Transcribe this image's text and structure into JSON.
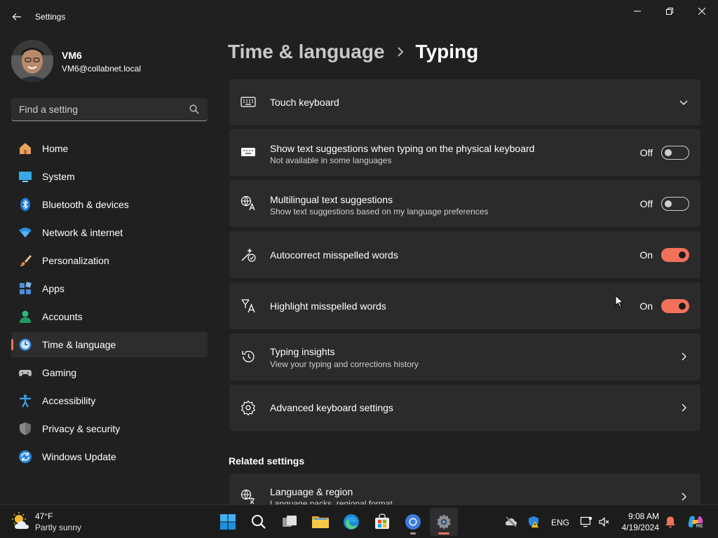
{
  "window": {
    "title": "Settings",
    "back_icon": "back-arrow-icon",
    "minimize_icon": "minimize-icon",
    "restore_icon": "restore-icon",
    "close_icon": "close-icon"
  },
  "profile": {
    "name": "VM6",
    "email": "VM6@collabnet.local"
  },
  "search": {
    "placeholder": "Find a setting",
    "value": ""
  },
  "sidebar": {
    "items": [
      {
        "label": "Home",
        "icon": "home-icon",
        "selected": false
      },
      {
        "label": "System",
        "icon": "system-icon",
        "selected": false
      },
      {
        "label": "Bluetooth & devices",
        "icon": "bluetooth-icon",
        "selected": false
      },
      {
        "label": "Network & internet",
        "icon": "wifi-icon",
        "selected": false
      },
      {
        "label": "Personalization",
        "icon": "brush-icon",
        "selected": false
      },
      {
        "label": "Apps",
        "icon": "apps-icon",
        "selected": false
      },
      {
        "label": "Accounts",
        "icon": "accounts-icon",
        "selected": false
      },
      {
        "label": "Time & language",
        "icon": "time-language-icon",
        "selected": true
      },
      {
        "label": "Gaming",
        "icon": "gaming-icon",
        "selected": false
      },
      {
        "label": "Accessibility",
        "icon": "accessibility-icon",
        "selected": false
      },
      {
        "label": "Privacy & security",
        "icon": "shield-icon",
        "selected": false
      },
      {
        "label": "Windows Update",
        "icon": "windows-update-icon",
        "selected": false
      }
    ]
  },
  "breadcrumb": {
    "parent": "Time & language",
    "current": "Typing"
  },
  "settings": [
    {
      "title": "Touch keyboard",
      "subtitle": "",
      "icon": "keyboard-icon",
      "control": "expand"
    },
    {
      "title": "Show text suggestions when typing on the physical keyboard",
      "subtitle": "Not available in some languages",
      "icon": "keyboard-icon",
      "control": "toggle",
      "state_label": "Off",
      "on": false
    },
    {
      "title": "Multilingual text suggestions",
      "subtitle": "Show text suggestions based on my language preferences",
      "icon": "language-suggestions-icon",
      "control": "toggle",
      "state_label": "Off",
      "on": false
    },
    {
      "title": "Autocorrect misspelled words",
      "subtitle": "",
      "icon": "autocorrect-icon",
      "control": "toggle",
      "state_label": "On",
      "on": true
    },
    {
      "title": "Highlight misspelled words",
      "subtitle": "",
      "icon": "highlight-spelling-icon",
      "control": "toggle",
      "state_label": "On",
      "on": true
    },
    {
      "title": "Typing insights",
      "subtitle": "View your typing and corrections history",
      "icon": "history-icon",
      "control": "link"
    },
    {
      "title": "Advanced keyboard settings",
      "subtitle": "",
      "icon": "gear-icon",
      "control": "link"
    }
  ],
  "related": {
    "heading": "Related settings",
    "items": [
      {
        "title": "Language & region",
        "subtitle": "Language packs, regional format",
        "icon": "language-region-icon",
        "control": "link"
      }
    ]
  },
  "taskbar": {
    "weather": {
      "temp": "47°F",
      "desc": "Partly sunny",
      "icon": "partly-sunny-icon"
    },
    "apps": [
      "windows-start-icon",
      "search-icon",
      "task-view-icon",
      "file-explorer-icon",
      "edge-icon",
      "store-icon",
      "chrome-icon",
      "settings-icon"
    ],
    "tray": {
      "language": "ENG",
      "time": "9:08 AM",
      "date": "4/19/2024"
    }
  },
  "colors": {
    "accent": "#f2715b",
    "background": "#202020",
    "card": "#2b2b2b"
  }
}
